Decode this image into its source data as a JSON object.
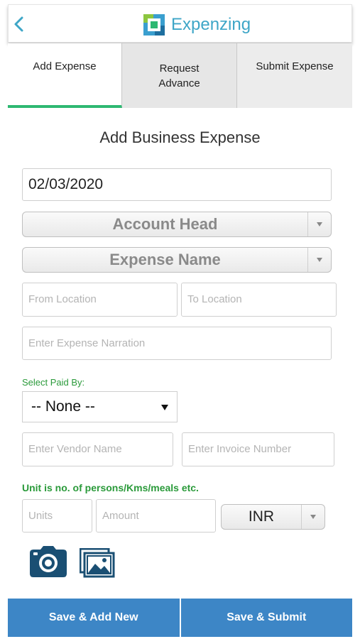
{
  "header": {
    "title": "Expenzing",
    "back_icon": "chevron-left-icon",
    "logo_icon": "expenzing-logo-icon",
    "accent_color": "#3ea6c7"
  },
  "tabs": [
    {
      "label": "Add Expense",
      "active": true
    },
    {
      "label": "Request Advance",
      "active": false
    },
    {
      "label": "Submit Expense",
      "active": false
    }
  ],
  "form": {
    "title": "Add Business Expense",
    "date_value": "02/03/2020",
    "account_head": "Account Head",
    "expense_name": "Expense Name",
    "from_location_placeholder": "From Location",
    "to_location_placeholder": "To Location",
    "narration_placeholder": "Enter Expense Narration",
    "paid_by_label": "Select Paid By:",
    "paid_by_value": "-- None --",
    "vendor_placeholder": "Enter Vendor Name",
    "invoice_placeholder": "Enter Invoice Number",
    "unit_note": "Unit is no. of persons/Kms/meals etc.",
    "units_placeholder": "Units",
    "amount_placeholder": "Amount",
    "currency_value": "INR"
  },
  "attachments": {
    "camera_icon": "camera-icon",
    "gallery_icon": "image-gallery-icon"
  },
  "buttons": {
    "save_add_new": "Save & Add New",
    "save_submit": "Save & Submit",
    "color": "#3d86c6"
  }
}
